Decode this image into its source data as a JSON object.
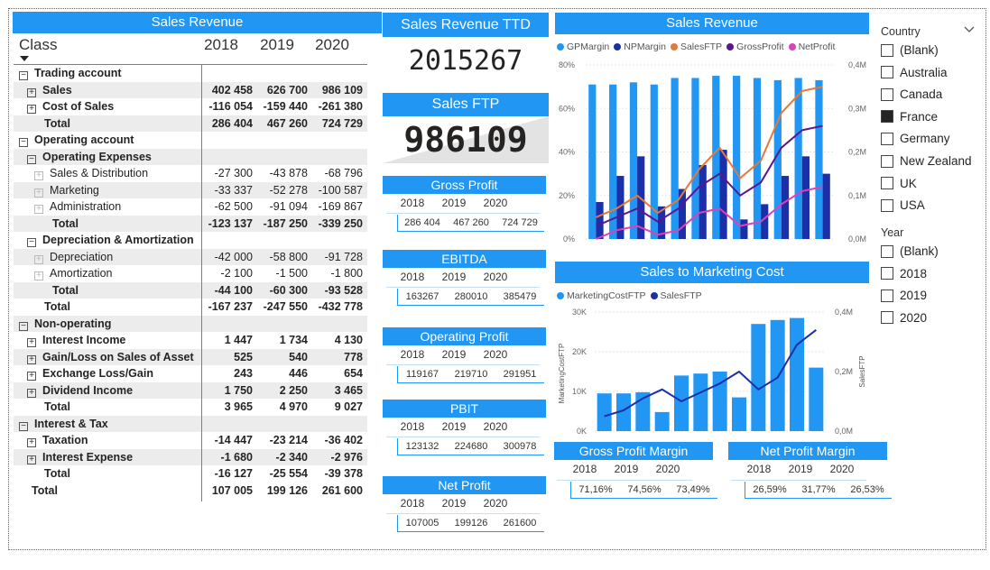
{
  "matrix": {
    "title": "Sales Revenue",
    "class_label": "Class",
    "years": [
      "2018",
      "2019",
      "2020"
    ],
    "rows": [
      {
        "label": "Trading account",
        "level": 0,
        "toggle": "⊟",
        "bold": true,
        "shade": false,
        "v": [
          "",
          "",
          ""
        ]
      },
      {
        "label": "Sales",
        "level": 1,
        "toggle": "⊞",
        "bold": true,
        "shade": true,
        "v": [
          "402 458",
          "626 700",
          "986 109"
        ]
      },
      {
        "label": "Cost of Sales",
        "level": 1,
        "toggle": "⊞",
        "bold": true,
        "shade": false,
        "v": [
          "-116 054",
          "-159 440",
          "-261 380"
        ]
      },
      {
        "label": "Total",
        "level": 2,
        "toggle": "",
        "bold": true,
        "shade": true,
        "v": [
          "286 404",
          "467 260",
          "724 729"
        ]
      },
      {
        "label": "Operating account",
        "level": 0,
        "toggle": "⊟",
        "bold": true,
        "shade": false,
        "v": [
          "",
          "",
          ""
        ]
      },
      {
        "label": "Operating Expenses",
        "level": 1,
        "toggle": "⊟",
        "bold": true,
        "shade": true,
        "v": [
          "",
          "",
          ""
        ]
      },
      {
        "label": "Sales & Distribution",
        "level": 2,
        "toggle": "⊞",
        "bold": false,
        "shade": false,
        "v": [
          "-27 300",
          "-43 878",
          "-68 796"
        ]
      },
      {
        "label": "Marketing",
        "level": 2,
        "toggle": "⊞",
        "bold": false,
        "shade": true,
        "v": [
          "-33 337",
          "-52 278",
          "-100 587"
        ]
      },
      {
        "label": "Administration",
        "level": 2,
        "toggle": "⊞",
        "bold": false,
        "shade": false,
        "v": [
          "-62 500",
          "-91 094",
          "-169 867"
        ]
      },
      {
        "label": "Total",
        "level": 3,
        "toggle": "",
        "bold": true,
        "shade": true,
        "v": [
          "-123 137",
          "-187 250",
          "-339 250"
        ]
      },
      {
        "label": "Depreciation & Amortization",
        "level": 1,
        "toggle": "⊟",
        "bold": true,
        "shade": false,
        "v": [
          "",
          "",
          ""
        ]
      },
      {
        "label": "Depreciation",
        "level": 2,
        "toggle": "⊞",
        "bold": false,
        "shade": true,
        "v": [
          "-42 000",
          "-58 800",
          "-91 728"
        ]
      },
      {
        "label": "Amortization",
        "level": 2,
        "toggle": "⊞",
        "bold": false,
        "shade": false,
        "v": [
          "-2 100",
          "-1 500",
          "-1 800"
        ]
      },
      {
        "label": "Total",
        "level": 3,
        "toggle": "",
        "bold": true,
        "shade": true,
        "v": [
          "-44 100",
          "-60 300",
          "-93 528"
        ]
      },
      {
        "label": "Total",
        "level": 2,
        "toggle": "",
        "bold": true,
        "shade": false,
        "v": [
          "-167 237",
          "-247 550",
          "-432 778"
        ]
      },
      {
        "label": "Non-operating",
        "level": 0,
        "toggle": "⊟",
        "bold": true,
        "shade": true,
        "v": [
          "",
          "",
          ""
        ]
      },
      {
        "label": "Interest Income",
        "level": 1,
        "toggle": "⊞",
        "bold": true,
        "shade": false,
        "v": [
          "1 447",
          "1 734",
          "4 130"
        ]
      },
      {
        "label": "Gain/Loss on Sales of Asset",
        "level": 1,
        "toggle": "⊞",
        "bold": true,
        "shade": true,
        "v": [
          "525",
          "540",
          "778"
        ]
      },
      {
        "label": "Exchange Loss/Gain",
        "level": 1,
        "toggle": "⊞",
        "bold": true,
        "shade": false,
        "v": [
          "243",
          "446",
          "654"
        ]
      },
      {
        "label": "Dividend Income",
        "level": 1,
        "toggle": "⊞",
        "bold": true,
        "shade": true,
        "v": [
          "1 750",
          "2 250",
          "3 465"
        ]
      },
      {
        "label": "Total",
        "level": 2,
        "toggle": "",
        "bold": true,
        "shade": false,
        "v": [
          "3 965",
          "4 970",
          "9 027"
        ]
      },
      {
        "label": "Interest & Tax",
        "level": 0,
        "toggle": "⊟",
        "bold": true,
        "shade": true,
        "v": [
          "",
          "",
          ""
        ]
      },
      {
        "label": "Taxation",
        "level": 1,
        "toggle": "⊞",
        "bold": true,
        "shade": false,
        "v": [
          "-14 447",
          "-23 214",
          "-36 402"
        ]
      },
      {
        "label": "Interest Expense",
        "level": 1,
        "toggle": "⊞",
        "bold": true,
        "shade": true,
        "v": [
          "-1 680",
          "-2 340",
          "-2 976"
        ]
      },
      {
        "label": "Total",
        "level": 2,
        "toggle": "",
        "bold": true,
        "shade": false,
        "v": [
          "-16 127",
          "-25 554",
          "-39 378"
        ]
      },
      {
        "label": "Total",
        "level": 1,
        "toggle": "",
        "bold": true,
        "shade": false,
        "v": [
          "107 005",
          "199 126",
          "261 600"
        ]
      }
    ]
  },
  "kpi": {
    "ttd_title": "Sales Revenue TTD",
    "ttd_value": "2015267",
    "ftp_title": "Sales FTP",
    "ftp_value": "986109"
  },
  "minis": [
    {
      "title": "Gross Profit",
      "years": [
        "2018",
        "2019",
        "2020"
      ],
      "values": [
        "286 404",
        "467 260",
        "724 729"
      ]
    },
    {
      "title": "EBITDA",
      "years": [
        "2018",
        "2019",
        "2020"
      ],
      "values": [
        "163267",
        "280010",
        "385479"
      ]
    },
    {
      "title": "Operating Profit",
      "years": [
        "2018",
        "2019",
        "2020"
      ],
      "values": [
        "119167",
        "219710",
        "291951"
      ]
    },
    {
      "title": "PBIT",
      "years": [
        "2018",
        "2019",
        "2020"
      ],
      "values": [
        "123132",
        "224680",
        "300978"
      ]
    },
    {
      "title": "Net Profit",
      "years": [
        "2018",
        "2019",
        "2020"
      ],
      "values": [
        "107005",
        "199126",
        "261600"
      ]
    }
  ],
  "margins": [
    {
      "title": "Gross Profit Margin",
      "years": [
        "2018",
        "2019",
        "2020"
      ],
      "values": [
        "71,16%",
        "74,56%",
        "73,49%"
      ]
    },
    {
      "title": "Net Profit Margin",
      "years": [
        "2018",
        "2019",
        "2020"
      ],
      "values": [
        "26,59%",
        "31,77%",
        "26,53%"
      ]
    }
  ],
  "chart_data": [
    {
      "type": "bar",
      "title": "Sales Revenue",
      "legend": [
        "GPMargin",
        "NPMargin",
        "SalesFTP",
        "GrossProfit",
        "NetProfit"
      ],
      "legend_colors": [
        "#2196f3",
        "#1a2fa8",
        "#e8773a",
        "#5b1591",
        "#e03fb8"
      ],
      "y_left_ticks": [
        "0%",
        "20%",
        "40%",
        "60%",
        "80%"
      ],
      "y_left_range": [
        0,
        0.8
      ],
      "y_right_ticks": [
        "0,0M",
        "0,1M",
        "0,2M",
        "0,3M",
        "0,4M"
      ],
      "y_right_range": [
        0,
        0.4
      ],
      "series": [
        {
          "name": "GPMargin",
          "values": [
            0.71,
            0.71,
            0.72,
            0.71,
            0.74,
            0.74,
            0.75,
            0.75,
            0.74,
            0.73,
            0.74,
            0.73
          ]
        },
        {
          "name": "NPMargin",
          "values": [
            0.17,
            0.29,
            0.38,
            0.15,
            0.23,
            0.34,
            0.41,
            0.09,
            0.16,
            0.29,
            0.38,
            0.3
          ]
        },
        {
          "name": "SalesFTP",
          "values": [
            0.05,
            0.07,
            0.1,
            0.06,
            0.09,
            0.16,
            0.21,
            0.14,
            0.18,
            0.29,
            0.34,
            0.35
          ]
        },
        {
          "name": "GrossProfit",
          "values": [
            0.03,
            0.05,
            0.07,
            0.04,
            0.07,
            0.12,
            0.15,
            0.1,
            0.13,
            0.21,
            0.25,
            0.26
          ]
        },
        {
          "name": "NetProfit",
          "values": [
            0.0,
            0.02,
            0.03,
            0.01,
            0.02,
            0.06,
            0.07,
            0.03,
            0.04,
            0.08,
            0.11,
            0.12
          ]
        }
      ]
    },
    {
      "type": "bar",
      "title": "Sales to Marketing Cost",
      "legend": [
        "MarketingCostFTP",
        "SalesFTP"
      ],
      "legend_colors": [
        "#2196f3",
        "#1a2fa8"
      ],
      "ylabel": "MarketingCostFTP",
      "y2label": "SalesFTP",
      "y_left_ticks": [
        "0K",
        "10K",
        "20K",
        "30K"
      ],
      "y_left_range": [
        0,
        30000
      ],
      "y_right_ticks": [
        "0,0M",
        "0,2M",
        "0,4M"
      ],
      "y_right_range": [
        0,
        0.4
      ],
      "series": [
        {
          "name": "MarketingCostFTP",
          "values": [
            9500,
            9500,
            9800,
            4800,
            14000,
            14500,
            15000,
            8500,
            27000,
            28000,
            28500,
            16000
          ]
        },
        {
          "name": "SalesFTP",
          "values": [
            0.05,
            0.07,
            0.11,
            0.14,
            0.1,
            0.13,
            0.16,
            0.2,
            0.14,
            0.18,
            0.29,
            0.34
          ]
        }
      ]
    }
  ],
  "slicers": {
    "country": {
      "title": "Country",
      "options": [
        {
          "label": "(Blank)",
          "checked": false
        },
        {
          "label": "Australia",
          "checked": false
        },
        {
          "label": "Canada",
          "checked": false
        },
        {
          "label": "France",
          "checked": true
        },
        {
          "label": "Germany",
          "checked": false
        },
        {
          "label": "New Zealand",
          "checked": false
        },
        {
          "label": "UK",
          "checked": false
        },
        {
          "label": "USA",
          "checked": false
        }
      ]
    },
    "year": {
      "title": "Year",
      "options": [
        {
          "label": "(Blank)",
          "checked": false
        },
        {
          "label": "2018",
          "checked": false
        },
        {
          "label": "2019",
          "checked": false
        },
        {
          "label": "2020",
          "checked": false
        }
      ]
    }
  },
  "colors": {
    "accent": "#2196f3",
    "dark_blue": "#1a2fa8"
  }
}
